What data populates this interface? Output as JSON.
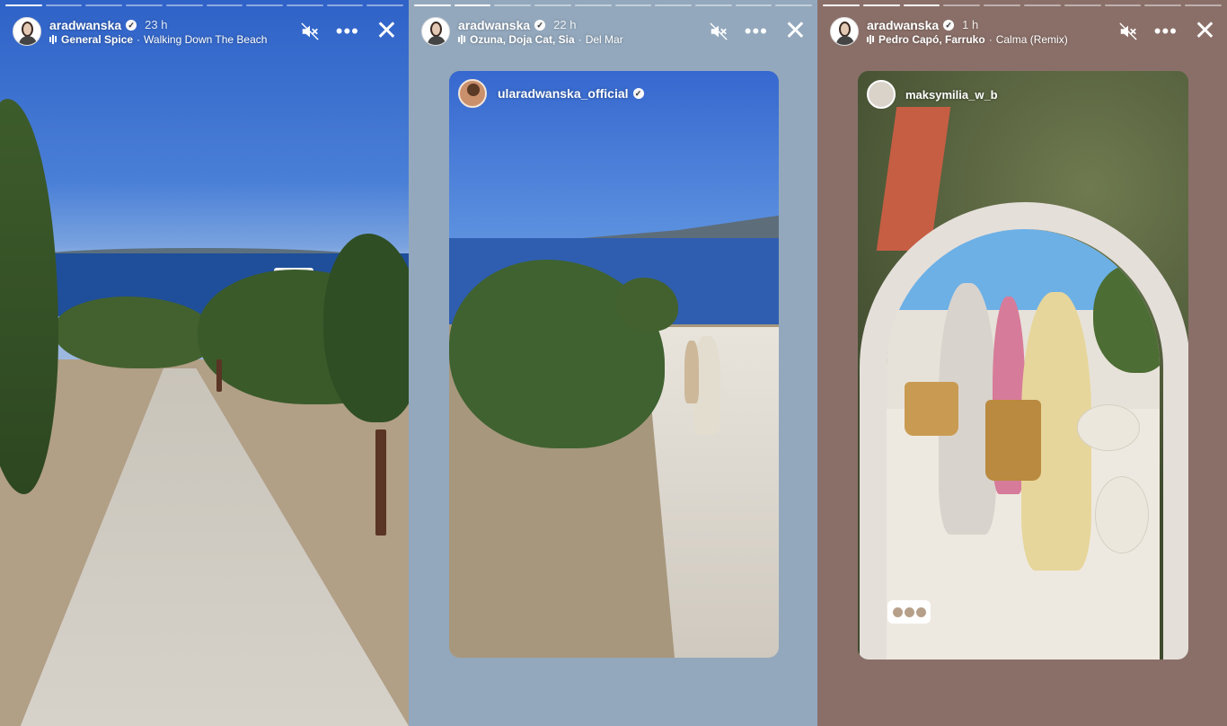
{
  "stories": [
    {
      "username": "aradwanska",
      "time": "23 h",
      "music_artist": "General Spice",
      "music_track": "Walking Down The Beach",
      "separator": "·",
      "progress": {
        "segments": 10,
        "active": 1
      }
    },
    {
      "username": "aradwanska",
      "time": "22 h",
      "music_artist": "Ozuna, Doja Cat, Sia",
      "music_track": "Del Mar",
      "separator": "·",
      "progress": {
        "segments": 10,
        "active": 2
      },
      "reshare_username": "ularadwanska_official"
    },
    {
      "username": "aradwanska",
      "time": "1 h",
      "music_artist": "Pedro Capó, Farruko",
      "music_track": "Calma (Remix)",
      "separator": "·",
      "progress": {
        "segments": 10,
        "active": 3
      },
      "reshare_username": "maksymilia_w_b"
    }
  ],
  "icons": {
    "mute": "muted-speaker-icon",
    "more": "more-options-icon",
    "close": "close-icon",
    "verified": "verified-badge-icon",
    "music": "music-bars-icon"
  },
  "glyphs": {
    "verified": "✓",
    "more": "•••",
    "close": "✕"
  }
}
